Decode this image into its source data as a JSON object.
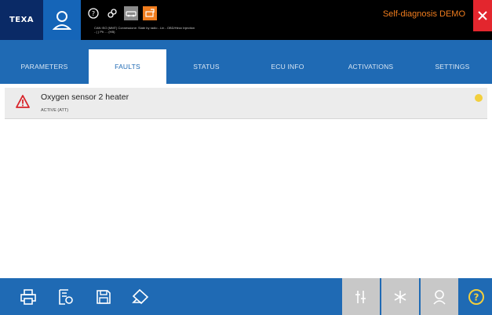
{
  "header": {
    "logo": "TEXA",
    "title": "Self-diagnosis DEMO",
    "connection_info_line1": "CAN ISO (MMT) Connessione: Slate by radio - Lin - OBD/Hirox Injection",
    "connection_info_line2": "- ( ) Ph - - (HB)"
  },
  "tabs": [
    {
      "label": "PARAMETERS",
      "active": false
    },
    {
      "label": "FAULTS",
      "active": true
    },
    {
      "label": "STATUS",
      "active": false
    },
    {
      "label": "ECU INFO",
      "active": false
    },
    {
      "label": "ACTIVATIONS",
      "active": false
    },
    {
      "label": "SETTINGS",
      "active": false
    }
  ],
  "faults": [
    {
      "title": "Oxygen sensor 2 heater",
      "status": "ACTIVE (ATT)",
      "indicator_color": "#f2cf3d"
    }
  ],
  "toolbar": {
    "left_icons": [
      "print-icon",
      "report-icon",
      "save-icon",
      "erase-icon"
    ],
    "right_icons": [
      "filter-icon",
      "freeze-frame-icon",
      "user-icon",
      "help-icon"
    ]
  },
  "colors": {
    "primary_blue": "#1f6ab4",
    "accent_orange": "#f07d1e",
    "close_red": "#e3262e",
    "warning_red": "#d8242a"
  }
}
